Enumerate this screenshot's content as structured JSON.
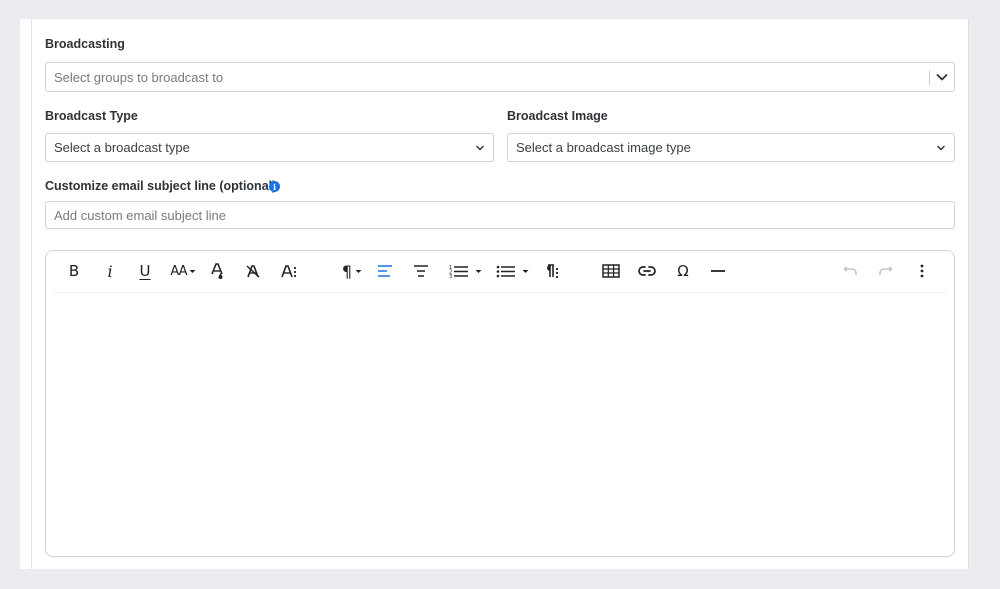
{
  "broadcasting": {
    "label": "Broadcasting",
    "placeholder": "Select groups to broadcast to"
  },
  "broadcast_type": {
    "label": "Broadcast Type",
    "placeholder": "Select a broadcast type"
  },
  "broadcast_image": {
    "label": "Broadcast Image",
    "placeholder": "Select a broadcast image type"
  },
  "subject": {
    "label": "Customize email subject line (optional)",
    "placeholder": "Add custom email subject line",
    "value": ""
  },
  "editor": {
    "toolbar": {
      "bold": "B",
      "italic": "i",
      "underline": "U",
      "font_size": "AA",
      "paragraph": "¶",
      "special_char": "Ω"
    },
    "content": ""
  },
  "colors": {
    "accent": "#1a73e8",
    "border": "#ced3d9",
    "background": "#ebecf0"
  }
}
